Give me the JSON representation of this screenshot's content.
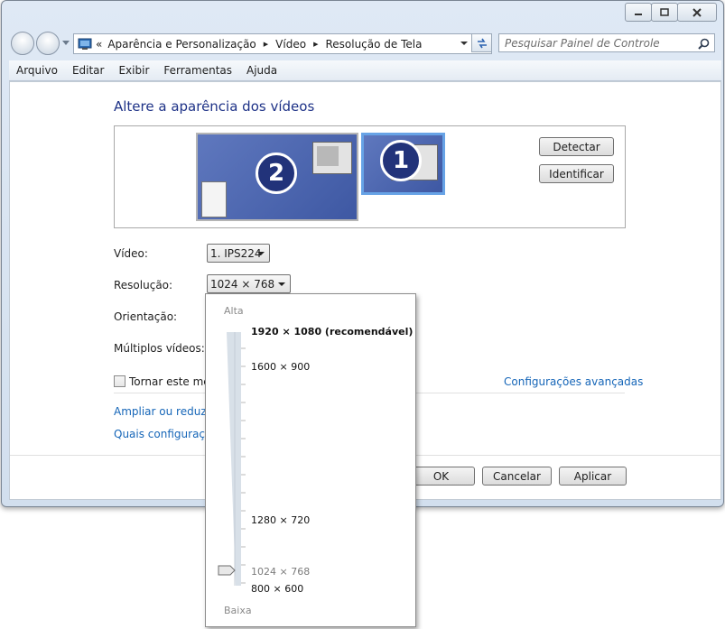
{
  "address": {
    "prefix": "«",
    "crumbs": [
      "Aparência e Personalização",
      "Vídeo",
      "Resolução de Tela"
    ]
  },
  "search": {
    "placeholder": "Pesquisar Painel de Controle"
  },
  "menu": [
    "Arquivo",
    "Editar",
    "Exibir",
    "Ferramentas",
    "Ajuda"
  ],
  "title": "Altere a aparência dos vídeos",
  "monitors": [
    {
      "number": "2"
    },
    {
      "number": "1"
    }
  ],
  "buttons": {
    "detect": "Detectar",
    "identify": "Identificar",
    "ok": "OK",
    "cancel": "Cancelar",
    "apply": "Aplicar"
  },
  "fields": {
    "video_label": "Vídeo:",
    "video_value": "1. IPS224",
    "resolution_label": "Resolução:",
    "resolution_value": "1024 × 768",
    "orientation_label": "Orientação:",
    "multi_label": "Múltiplos vídeos:"
  },
  "checkbox": {
    "label": "Tornar este meu",
    "checked": false
  },
  "links": {
    "advanced": "Configurações avançadas",
    "enlarge": "Ampliar ou reduzir",
    "which": "Quais configuraçõe"
  },
  "popup": {
    "high": "Alta",
    "low": "Baixa",
    "options": [
      {
        "label": "1920 × 1080 (recomendável)",
        "style": "bold"
      },
      {
        "label": "1600 × 900",
        "style": "normal"
      },
      {
        "label": "1280 × 720",
        "style": "normal"
      },
      {
        "label": "1024 × 768",
        "style": "selected"
      },
      {
        "label": "800 × 600",
        "style": "normal"
      }
    ],
    "slider_position": "1024 × 768"
  },
  "colors": {
    "title": "#1e3287",
    "link": "#1666b8",
    "monitor_fill": "#3c5aa8"
  }
}
